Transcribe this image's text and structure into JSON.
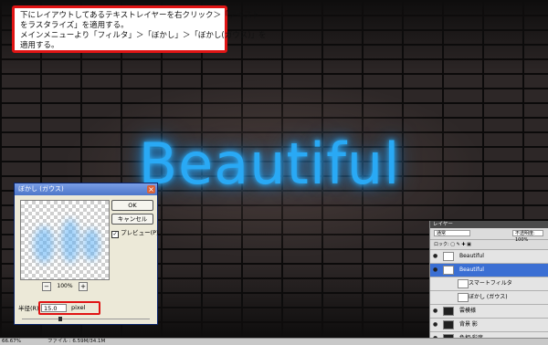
{
  "note": {
    "lines": [
      "下にレイアウトしてあるテキストレイヤーを右クリック＞「テキスト",
      "をラスタライズ」を適用する。",
      "メインメニューより「フィルタ」＞「ぼかし」＞「ぼかし(ガウス)」を",
      "適用する。"
    ]
  },
  "canvas": {
    "title_text": "Beautiful"
  },
  "dialog": {
    "title": "ぼかし (ガウス)",
    "ok_label": "OK",
    "cancel_label": "キャンセル",
    "preview_label": "プレビュー(P)",
    "preview_checked": "✓",
    "zoom": "100%",
    "zoom_minus": "−",
    "zoom_plus": "+",
    "radius_label": "半径(R):",
    "radius_value": "15.0",
    "radius_unit": "pixel"
  },
  "layers": {
    "tab": "レイヤー",
    "blend_mode": "通常",
    "opacity": "不透明度: 100%",
    "locks": "ロック: ▢ ✎ ✚ ▣",
    "rows": [
      {
        "name": "Beautiful",
        "type": "text"
      },
      {
        "name": "Beautiful",
        "type": "selected"
      },
      {
        "name": "スマートフィルタ",
        "type": "sub"
      },
      {
        "name": "ぼかし (ガウス)",
        "type": "sub"
      },
      {
        "name": "雲模様",
        "type": "normal"
      },
      {
        "name": "背景 影",
        "type": "normal"
      },
      {
        "name": "色相·彩度",
        "type": "normal"
      }
    ]
  },
  "status": {
    "zoom": "66.67%",
    "doc": "ファイル : 6.59M/34.1M"
  },
  "colors": {
    "glow": "#29a9f5",
    "highlight": "#e01414"
  }
}
